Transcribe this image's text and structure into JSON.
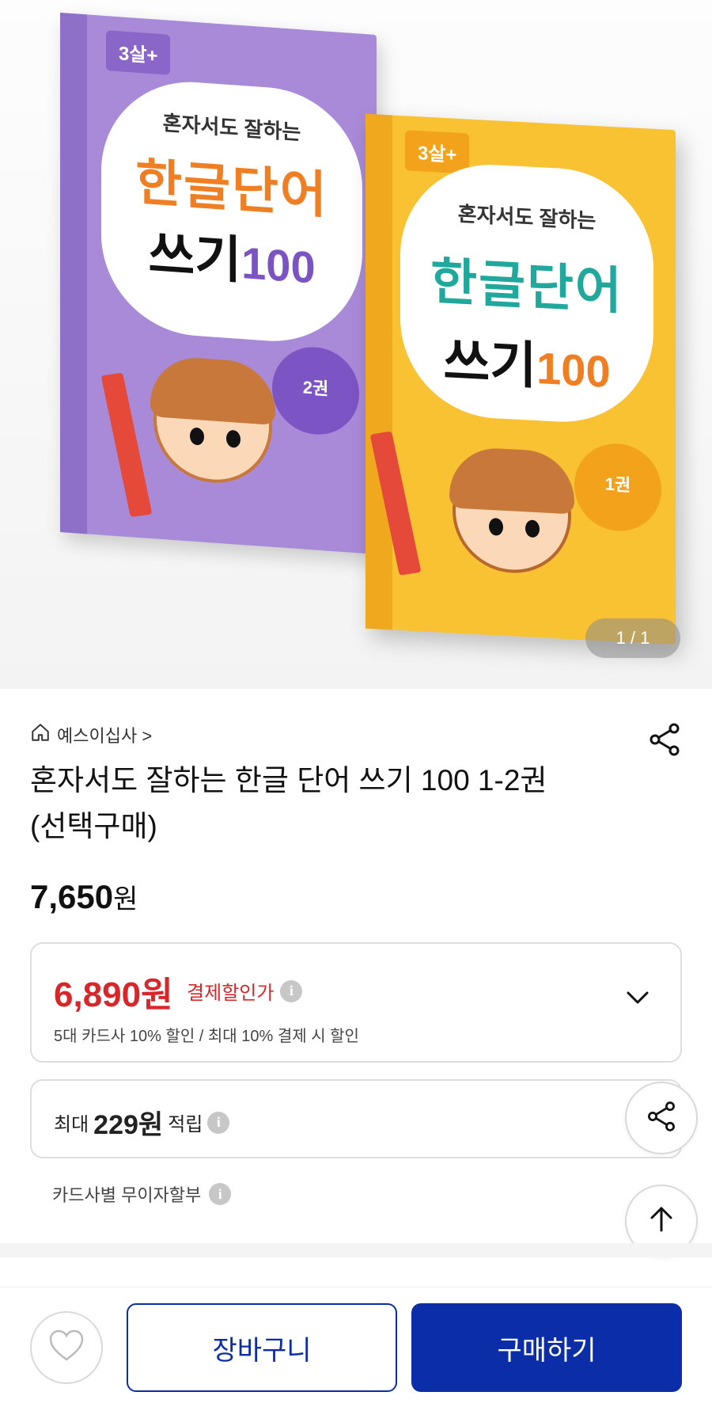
{
  "hero": {
    "books": [
      {
        "age": "3살+",
        "tagline": "혼자서도 잘하는",
        "title_line1": "한글단어",
        "title_line2": "쓰기",
        "title_num": "100",
        "volume": "2권"
      },
      {
        "age": "3살+",
        "tagline": "혼자서도 잘하는",
        "title_line1": "한글단어",
        "title_line2": "쓰기",
        "title_num": "100",
        "volume": "1권"
      }
    ],
    "image_counter": "1 / 1"
  },
  "product": {
    "seller": "예스이십사 >",
    "title": "혼자서도 잘하는 한글 단어 쓰기 100 1-2권 (선택구매)",
    "price": "7,650",
    "price_unit": "원"
  },
  "discount": {
    "price": "6,890원",
    "label": "결제할인가",
    "description": "5대 카드사 10% 할인 / 최대 10% 결제 시 할인"
  },
  "points": {
    "prefix": "최대",
    "amount": "229원",
    "suffix": "적립"
  },
  "installment": {
    "label": "카드사별 무이자할부"
  },
  "actions": {
    "cart": "장바구니",
    "buy": "구매하기"
  },
  "colors": {
    "accent_blue": "#0b2ea8",
    "discount_red": "#d8262a"
  },
  "icons": {
    "home": "home-icon",
    "share": "share-icon",
    "info": "info-icon",
    "chevron": "chevron-down-icon",
    "scroll_top": "arrow-up-icon",
    "wish": "heart-icon"
  }
}
